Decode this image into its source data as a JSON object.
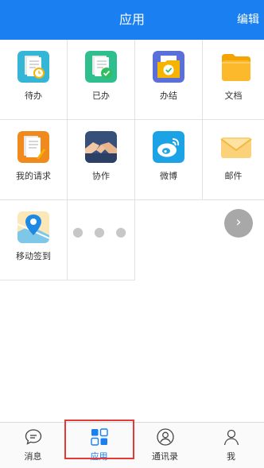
{
  "header": {
    "title": "应用",
    "edit_label": "编辑"
  },
  "apps": [
    {
      "label": "待办",
      "icon": "todo-doc-clock-icon"
    },
    {
      "label": "已办",
      "icon": "done-doc-check-icon"
    },
    {
      "label": "办结",
      "icon": "finished-folder-icon"
    },
    {
      "label": "文档",
      "icon": "documents-folder-icon"
    },
    {
      "label": "我的请求",
      "icon": "my-request-doc-icon"
    },
    {
      "label": "协作",
      "icon": "handshake-icon"
    },
    {
      "label": "微博",
      "icon": "weibo-icon"
    },
    {
      "label": "邮件",
      "icon": "mail-envelope-icon"
    },
    {
      "label": "移动签到",
      "icon": "location-checkin-icon"
    }
  ],
  "tabs": [
    {
      "label": "消息",
      "icon": "chat-bubble-icon",
      "active": false
    },
    {
      "label": "应用",
      "icon": "apps-grid-icon",
      "active": true
    },
    {
      "label": "通讯录",
      "icon": "contacts-icon",
      "active": false
    },
    {
      "label": "我",
      "icon": "profile-icon",
      "active": false
    }
  ],
  "colors": {
    "accent": "#1a7ff0",
    "highlight": "#e53935"
  }
}
